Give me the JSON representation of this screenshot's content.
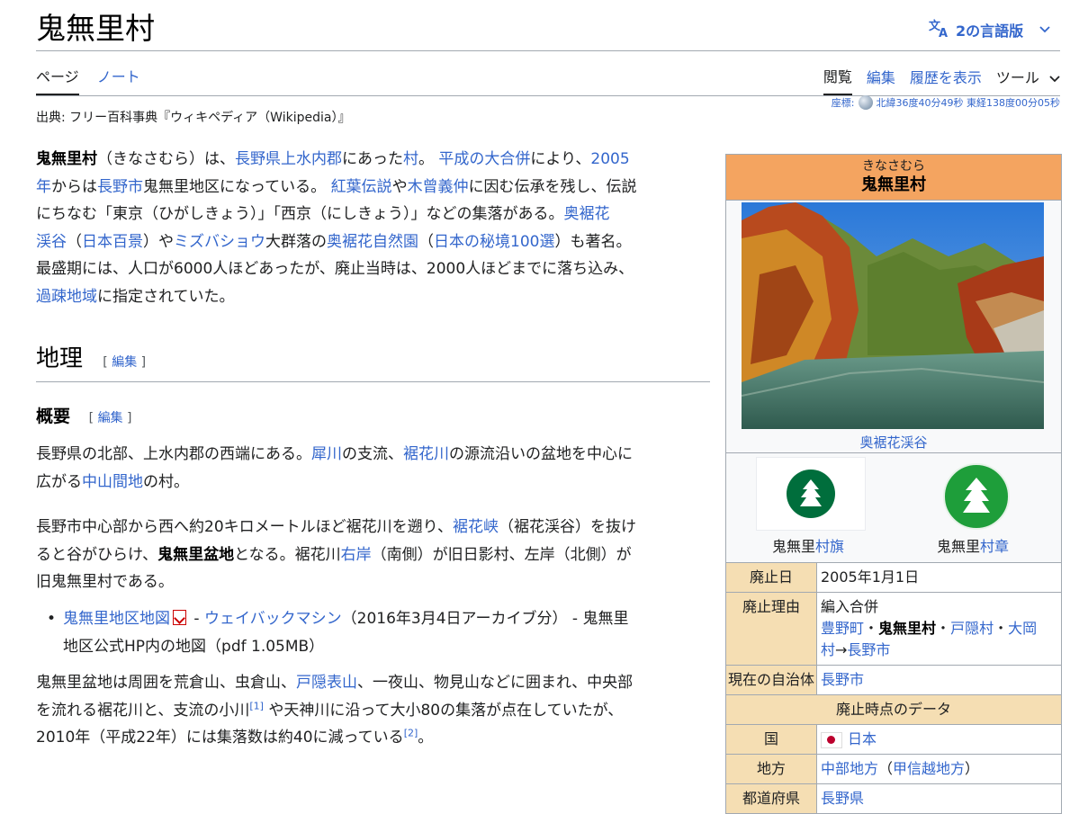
{
  "page": {
    "title": "鬼無里村",
    "languages": "2の言語版",
    "from": "出典: フリー百科事典『ウィキペディア（Wikipedia）』"
  },
  "tabs_left": [
    "ページ",
    "ノート"
  ],
  "tabs_right": [
    "閲覧",
    "編集",
    "履歴を表示",
    "ツール"
  ],
  "coords": {
    "label": "座標:",
    "value": "北緯36度40分49秒 東経138度00分05秒"
  },
  "intro": {
    "l1": [
      "鬼無里村",
      "（きなさむら）は、",
      "長野県",
      "上水内郡",
      "にあった",
      "村",
      "。 ",
      "平成の大合併",
      "により、",
      "2005"
    ],
    "l2": [
      "年",
      "からは",
      "長野市",
      "鬼無里地区になっている。 ",
      "紅葉伝説",
      "や",
      "木曾義仲",
      "に因む伝承を残し、伝説"
    ],
    "l3": "にちなむ「東京（ひがしきょう）」「西京（にしきょう）」などの集落がある。",
    "l3_link": "奥裾花",
    "l4": [
      "渓谷",
      "（",
      "日本百景",
      "）や",
      "ミズバショウ",
      "大群落の",
      "奥裾花自然園",
      "（",
      "日本の秘境100選",
      "）も著名。"
    ],
    "l5": "最盛期には、人口が6000人ほどあったが、廃止当時は、2000人ほどまでに落ち込み、",
    "l6": [
      "過疎地域",
      "に指定されていた。"
    ]
  },
  "section": {
    "title": "地理",
    "edit": "編集"
  },
  "subsection": {
    "title": "概要",
    "edit": "編集"
  },
  "p1": {
    "l1": [
      "長野県の北部、上水内郡の西端にある。",
      "犀川",
      "の支流、",
      "裾花川",
      "の源流沿いの盆地を中心に"
    ],
    "l2": [
      "広がる",
      "中山間地",
      "の村。"
    ]
  },
  "p2": {
    "l1": [
      "長野市中心部から西へ約20キロメートルほど裾花川を遡り、",
      "裾花峡",
      "（裾花渓谷）を抜け"
    ],
    "l2": [
      "ると谷がひらけ、",
      "鬼無里盆地",
      "となる。裾花川",
      "右岸",
      "（南側）が旧日影村、左岸（北側）が"
    ],
    "l3": "旧鬼無里村である。"
  },
  "bullet": {
    "l1": [
      "鬼無里地区地図",
      " - ",
      "ウェイバックマシン",
      "（2016年3月4日アーカイブ分） - 鬼無里"
    ],
    "l2": "地区公式HP内の地図（pdf 1.05MB）"
  },
  "p3": {
    "l1": [
      "鬼無里盆地は周囲を荒倉山、虫倉山、",
      "戸隠表山",
      "、一夜山、物見山などに囲まれ、中央部"
    ],
    "l2": [
      "を流れる裾花川と、支流の小川",
      "[1]",
      " や天神川に沿って大小80の集落が点在していたが、"
    ],
    "l3": [
      "2010年（平成22年）には集落数は約40に減っている",
      "[2]",
      "。"
    ]
  },
  "infobox": {
    "kana": "きなさむら",
    "name": "鬼無里村",
    "photo_caption": "奥裾花渓谷",
    "flag_label": [
      "鬼無里",
      "村旗"
    ],
    "emblem_label": [
      "鬼無里",
      "村章"
    ],
    "rows": {
      "abolish_date_k": "廃止日",
      "abolish_date_v": "2005年1月1日",
      "reason_k": "廃止理由",
      "reason_v1": "編入合併",
      "reason_links": [
        "豊野町",
        "・",
        "鬼無里村",
        "・",
        "戸隠村",
        "・",
        "大岡",
        "村",
        "→",
        "長野市"
      ],
      "current_k": "現在の自治体",
      "current_v": "長野市",
      "data_header": "廃止時点のデータ",
      "country_k": "国",
      "country_v": "日本",
      "region_k": "地方",
      "region_v1": "中部地方",
      "region_v2": "（",
      "region_v3": "甲信越地方",
      "region_v4": "）",
      "pref_k": "都道府県",
      "pref_v": "長野県"
    }
  },
  "colors": {
    "link": "#3366cc",
    "infobox_header": "#f4a460",
    "infobox_key": "#f5deb3",
    "emblem_green": "#006e3c"
  }
}
